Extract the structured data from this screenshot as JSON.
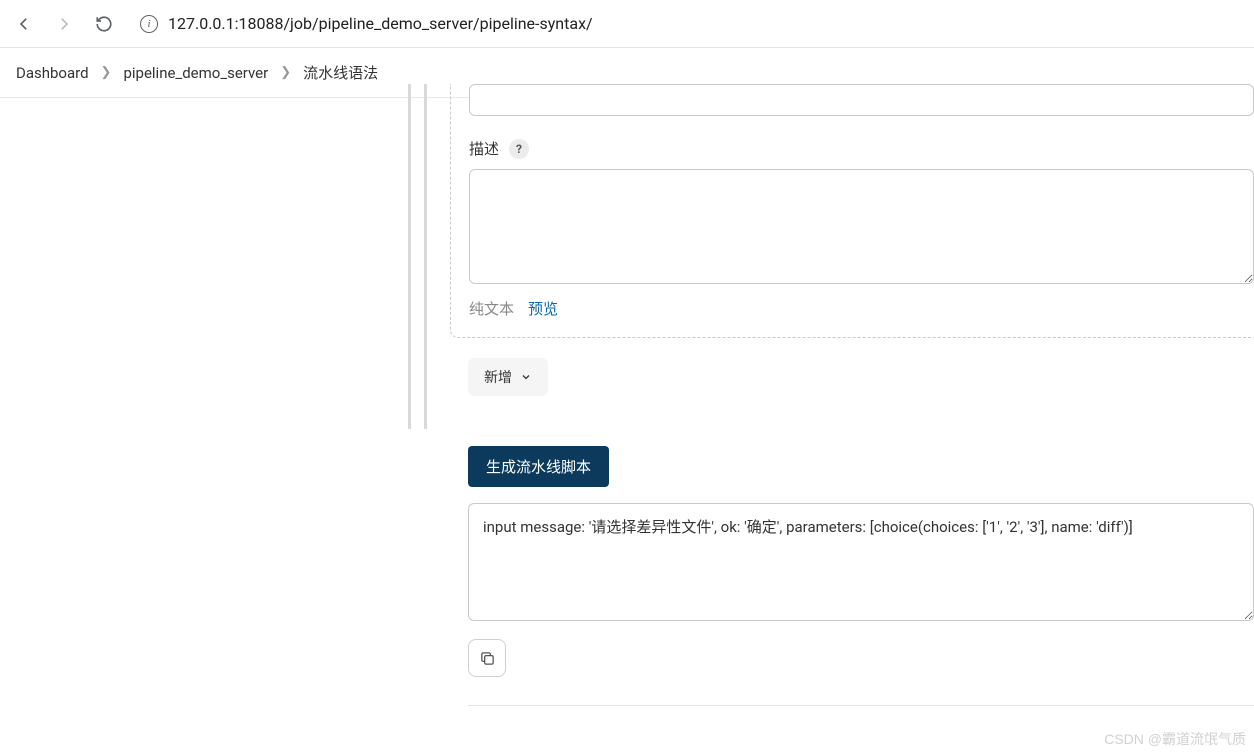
{
  "browser": {
    "url": "127.0.0.1:18088/job/pipeline_demo_server/pipeline-syntax/"
  },
  "breadcrumb": {
    "items": [
      "Dashboard",
      "pipeline_demo_server",
      "流水线语法"
    ]
  },
  "form": {
    "top_input_value": "",
    "description_label": "描述",
    "description_value": "",
    "mode_plain": "纯文本",
    "mode_preview": "预览",
    "add_button": "新增",
    "generate_button": "生成流水线脚本",
    "script_output": "input message: '请选择差异性文件', ok: '确定', parameters: [choice(choices: ['1', '2', '3'], name: 'diff')]"
  },
  "watermark": "CSDN @霸道流氓气质"
}
